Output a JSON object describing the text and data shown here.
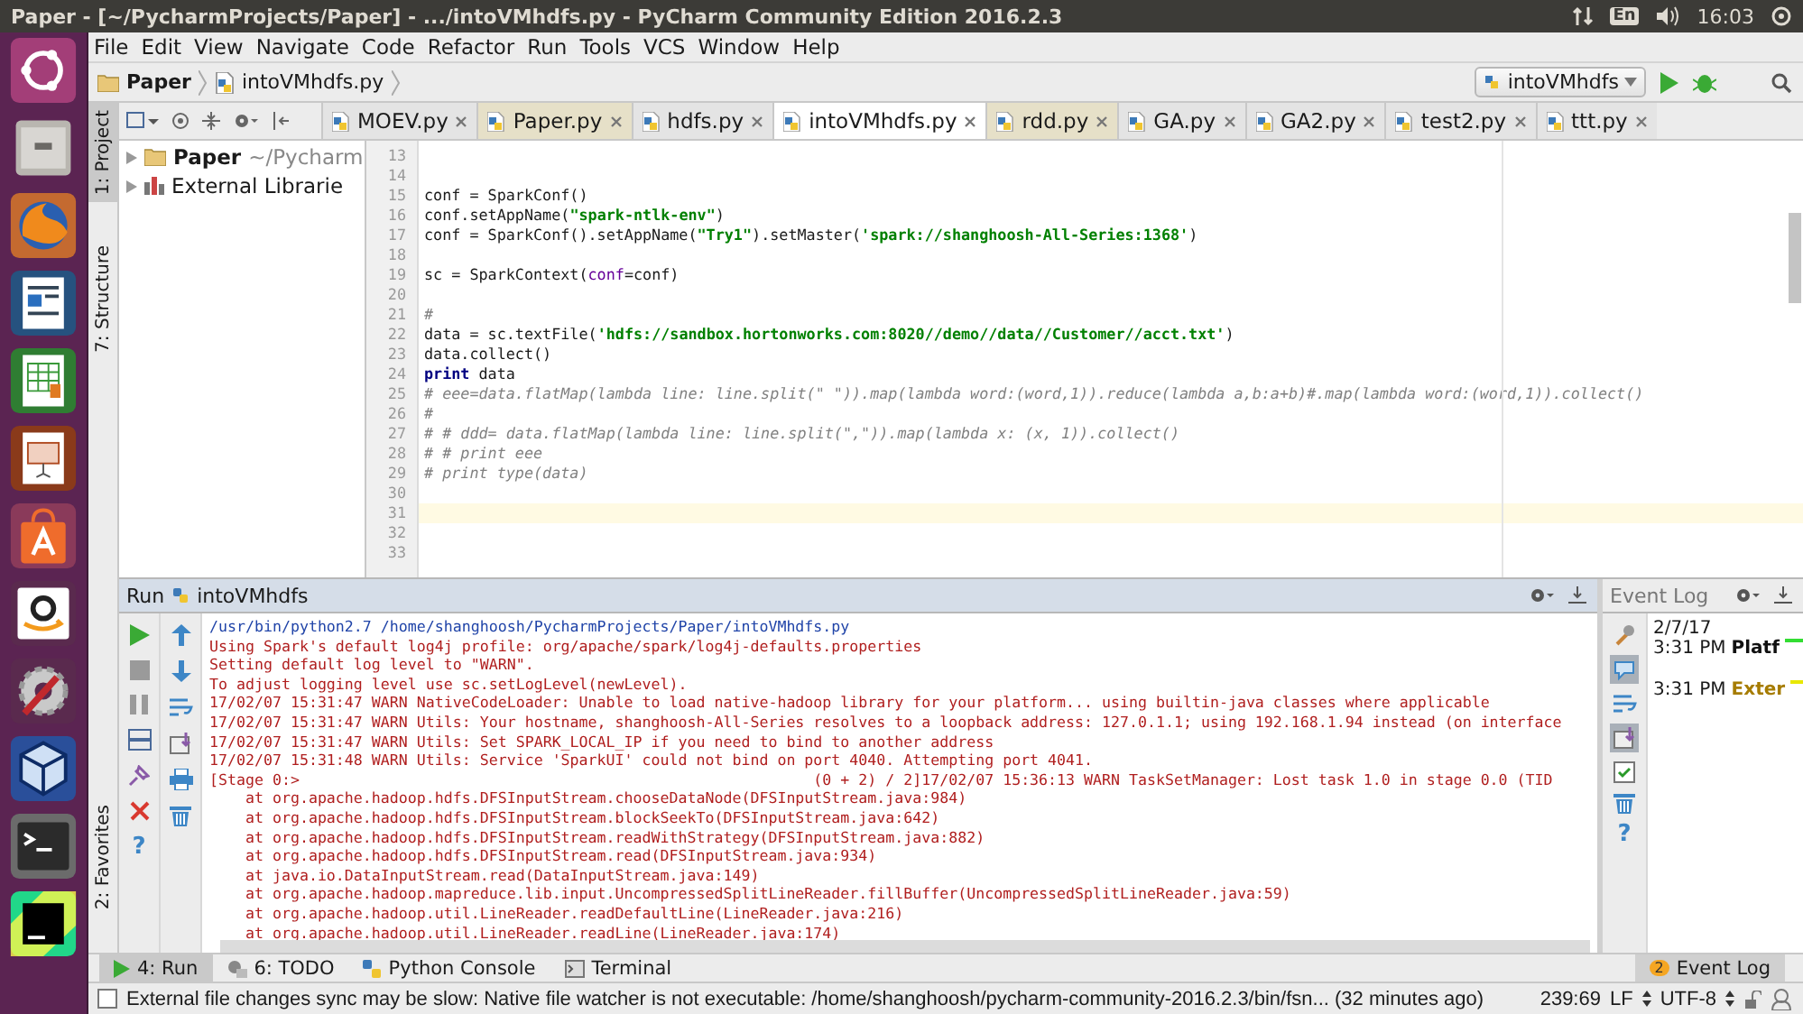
{
  "window": {
    "title": "Paper - [~/PycharmProjects/Paper] - .../intoVMhdfs.py - PyCharm Community Edition 2016.2.3"
  },
  "system_tray": {
    "keyboard_layout": "En",
    "clock": "16:03"
  },
  "menu": [
    "File",
    "Edit",
    "View",
    "Navigate",
    "Code",
    "Refactor",
    "Run",
    "Tools",
    "VCS",
    "Window",
    "Help"
  ],
  "breadcrumbs": [
    {
      "label": "Paper",
      "kind": "folder"
    },
    {
      "label": "intoVMhdfs.py",
      "kind": "file"
    }
  ],
  "run_config": {
    "label": "intoVMhdfs"
  },
  "side_tabs": [
    {
      "label": "1: Project",
      "selected": true,
      "kind": "project"
    },
    {
      "label": "7: Structure",
      "selected": false,
      "kind": "structure"
    },
    {
      "label": "2: Favorites",
      "selected": false,
      "kind": "favorites"
    }
  ],
  "editor_tabs": [
    {
      "label": "MOEV.py",
      "selected": false,
      "highlighted": false
    },
    {
      "label": "Paper.py",
      "selected": false,
      "highlighted": true
    },
    {
      "label": "hdfs.py",
      "selected": false,
      "highlighted": false
    },
    {
      "label": "intoVMhdfs.py",
      "selected": true,
      "highlighted": false
    },
    {
      "label": "rdd.py",
      "selected": false,
      "highlighted": true
    },
    {
      "label": "GA.py",
      "selected": false,
      "highlighted": false
    },
    {
      "label": "GA2.py",
      "selected": false,
      "highlighted": false
    },
    {
      "label": "test2.py",
      "selected": false,
      "highlighted": false
    },
    {
      "label": "ttt.py",
      "selected": false,
      "highlighted": false
    }
  ],
  "project_tree": [
    {
      "label": "Paper",
      "path": "~/Pycharm",
      "kind": "folder"
    },
    {
      "label": "External Librarie",
      "kind": "library"
    }
  ],
  "editor": {
    "lines": [
      {
        "number": "13",
        "current": false
      },
      {
        "number": "14",
        "current": false
      },
      {
        "number": "15",
        "current": false,
        "tokens": [
          {
            "kind": "plain",
            "text": "conf = SparkConf()"
          }
        ]
      },
      {
        "number": "16",
        "current": false,
        "tokens": [
          {
            "kind": "plain",
            "text": "conf.setAppName("
          },
          {
            "kind": "string",
            "text": "\"spark-ntlk-env\""
          },
          {
            "kind": "plain",
            "text": ")"
          }
        ]
      },
      {
        "number": "17",
        "current": false,
        "tokens": [
          {
            "kind": "plain",
            "text": "conf = SparkConf().setAppName("
          },
          {
            "kind": "string",
            "text": "\"Try1\""
          },
          {
            "kind": "plain",
            "text": ").setMaster("
          },
          {
            "kind": "string",
            "text": "'spark://shanghoosh-All-Series:1368'"
          },
          {
            "kind": "plain",
            "text": ")"
          }
        ]
      },
      {
        "number": "18",
        "current": false
      },
      {
        "number": "19",
        "current": false,
        "tokens": [
          {
            "kind": "plain",
            "text": "sc = SparkContext("
          },
          {
            "kind": "param",
            "text": "conf"
          },
          {
            "kind": "plain",
            "text": "=conf)"
          }
        ]
      },
      {
        "number": "20",
        "current": false
      },
      {
        "number": "21",
        "current": false,
        "tokens": [
          {
            "kind": "comment",
            "text": "#"
          }
        ]
      },
      {
        "number": "22",
        "current": false,
        "tokens": [
          {
            "kind": "plain",
            "text": "data = sc.textFile("
          },
          {
            "kind": "string",
            "text": "'hdfs://sandbox.hortonworks.com:8020//demo//data//Customer//acct.txt'"
          },
          {
            "kind": "plain",
            "text": ")"
          }
        ]
      },
      {
        "number": "23",
        "current": false,
        "tokens": [
          {
            "kind": "plain",
            "text": "data.collect()"
          }
        ]
      },
      {
        "number": "24",
        "current": false,
        "tokens": [
          {
            "kind": "keyword",
            "text": "print"
          },
          {
            "kind": "plain",
            "text": " data"
          }
        ]
      },
      {
        "number": "25",
        "current": false,
        "tokens": [
          {
            "kind": "comment",
            "text": "# eee=data.flatMap(lambda line: line.split(\" \")).map(lambda word:(word,1)).reduce(lambda a,b:a+b)#.map(lambda word:(word,1)).collect()"
          }
        ]
      },
      {
        "number": "26",
        "current": false,
        "tokens": [
          {
            "kind": "comment",
            "text": "#"
          }
        ]
      },
      {
        "number": "27",
        "current": false,
        "tokens": [
          {
            "kind": "comment",
            "text": "# # ddd= data.flatMap(lambda line: line.split(\",\")).map(lambda x: (x, 1)).collect()"
          }
        ]
      },
      {
        "number": "28",
        "current": false,
        "tokens": [
          {
            "kind": "comment",
            "text": "# # print eee"
          }
        ]
      },
      {
        "number": "29",
        "current": false,
        "tokens": [
          {
            "kind": "comment",
            "text": "# print type(data)"
          }
        ]
      },
      {
        "number": "30",
        "current": false
      },
      {
        "number": "31",
        "current": true
      },
      {
        "number": "32",
        "current": false
      },
      {
        "number": "33",
        "current": false
      }
    ]
  },
  "run_panel": {
    "title": "Run",
    "config": "intoVMhdfs",
    "help": "?",
    "lines": [
      {
        "kind": "command",
        "text": "/usr/bin/python2.7 /home/shanghoosh/PycharmProjects/Paper/intoVMhdfs.py"
      },
      {
        "kind": "error",
        "text": "Using Spark's default log4j profile: org/apache/spark/log4j-defaults.properties"
      },
      {
        "kind": "error",
        "text": "Setting default log level to \"WARN\"."
      },
      {
        "kind": "error",
        "text": "To adjust logging level use sc.setLogLevel(newLevel)."
      },
      {
        "kind": "error",
        "text": "17/02/07 15:31:47 WARN NativeCodeLoader: Unable to load native-hadoop library for your platform... using builtin-java classes where applicable"
      },
      {
        "kind": "error",
        "text": "17/02/07 15:31:47 WARN Utils: Your hostname, shanghoosh-All-Series resolves to a loopback address: 127.0.1.1; using 192.168.1.94 instead (on interface"
      },
      {
        "kind": "error",
        "text": "17/02/07 15:31:47 WARN Utils: Set SPARK_LOCAL_IP if you need to bind to another address"
      },
      {
        "kind": "error",
        "text": "17/02/07 15:31:48 WARN Utils: Service 'SparkUI' could not bind on port 4040. Attempting port 4041."
      },
      {
        "kind": "error",
        "text": "[Stage 0:>                                                         (0 + 2) / 2]17/02/07 15:36:13 WARN TaskSetManager: Lost task 1.0 in stage 0.0 (TID"
      },
      {
        "kind": "error",
        "text": "    at org.apache.hadoop.hdfs.DFSInputStream.chooseDataNode(DFSInputStream.java:984)"
      },
      {
        "kind": "error",
        "text": "    at org.apache.hadoop.hdfs.DFSInputStream.blockSeekTo(DFSInputStream.java:642)"
      },
      {
        "kind": "error",
        "text": "    at org.apache.hadoop.hdfs.DFSInputStream.readWithStrategy(DFSInputStream.java:882)"
      },
      {
        "kind": "error",
        "text": "    at org.apache.hadoop.hdfs.DFSInputStream.read(DFSInputStream.java:934)"
      },
      {
        "kind": "error",
        "text": "    at java.io.DataInputStream.read(DataInputStream.java:149)"
      },
      {
        "kind": "error",
        "text": "    at org.apache.hadoop.mapreduce.lib.input.UncompressedSplitLineReader.fillBuffer(UncompressedSplitLineReader.java:59)"
      },
      {
        "kind": "error",
        "text": "    at org.apache.hadoop.util.LineReader.readDefaultLine(LineReader.java:216)"
      },
      {
        "kind": "error",
        "text": "    at org.apache.hadoop.util.LineReader.readLine(LineReader.java:174)"
      }
    ]
  },
  "event_log": {
    "title": "Event Log",
    "date": "2/7/17",
    "help": "?",
    "entries": [
      {
        "time": "3:31 PM",
        "text": "Platf",
        "kind": "info",
        "color": "#33dd33"
      },
      {
        "time": "3:31 PM",
        "text": "Exter",
        "kind": "warning",
        "color": "#e8e800"
      }
    ]
  },
  "tool_windows": [
    {
      "label": "4: Run",
      "selected": true,
      "kind": "run"
    },
    {
      "label": "6: TODO",
      "selected": false,
      "kind": "todo"
    },
    {
      "label": "Python Console",
      "selected": false,
      "kind": "console"
    },
    {
      "label": "Terminal",
      "selected": false,
      "kind": "terminal"
    }
  ],
  "event_log_button": {
    "label": "Event Log",
    "count": "2"
  },
  "status_bar": {
    "message": "External file changes sync may be slow: Native file watcher is not executable: /home/shanghoosh/pycharm-community-2016.2.3/bin/fsn... (32 minutes ago)",
    "position": "239:69",
    "line_separator": "LF",
    "encoding": "UTF-8"
  }
}
